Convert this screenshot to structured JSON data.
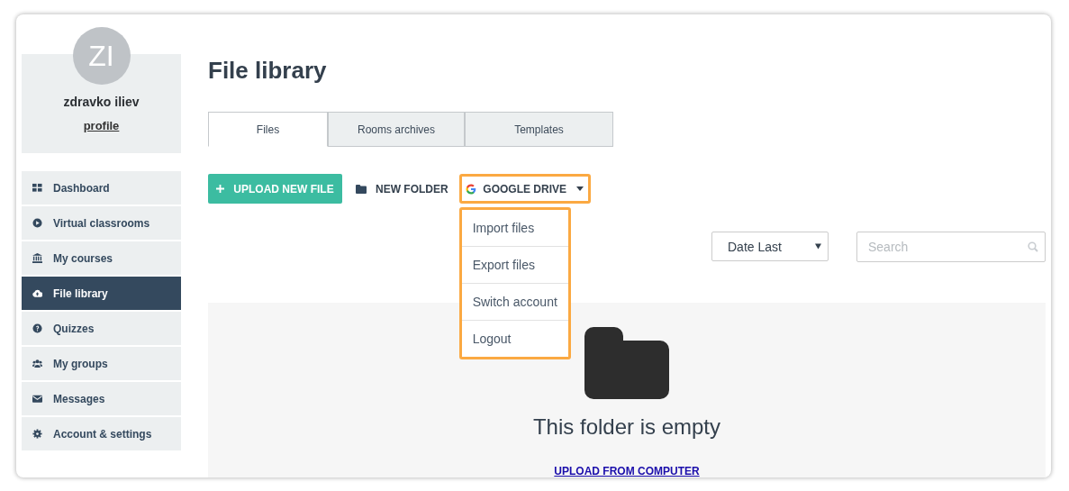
{
  "profile": {
    "initials": "ZI",
    "name": "zdravko iliev",
    "link": "profile"
  },
  "sidebar": {
    "items": [
      {
        "label": "Dashboard",
        "selected": false
      },
      {
        "label": "Virtual classrooms",
        "selected": false
      },
      {
        "label": "My courses",
        "selected": false
      },
      {
        "label": "File library",
        "selected": true
      },
      {
        "label": "Quizzes",
        "selected": false
      },
      {
        "label": "My groups",
        "selected": false
      },
      {
        "label": "Messages",
        "selected": false
      },
      {
        "label": "Account & settings",
        "selected": false
      }
    ]
  },
  "page_title": "File library",
  "tabs": [
    {
      "label": "Files",
      "selected": true
    },
    {
      "label": "Rooms archives",
      "selected": false
    },
    {
      "label": "Templates",
      "selected": false
    }
  ],
  "toolbar": {
    "upload": "UPLOAD NEW FILE",
    "new_folder": "NEW FOLDER",
    "google_drive": "GOOGLE DRIVE"
  },
  "drive_menu": {
    "expanded": true,
    "items": [
      "Import files",
      "Export files",
      "Switch account",
      "Logout"
    ]
  },
  "sort": {
    "value": "Date Last"
  },
  "search": {
    "placeholder": "Search"
  },
  "empty": {
    "message": "This folder is empty",
    "link": "UPLOAD FROM COMPUTER"
  }
}
